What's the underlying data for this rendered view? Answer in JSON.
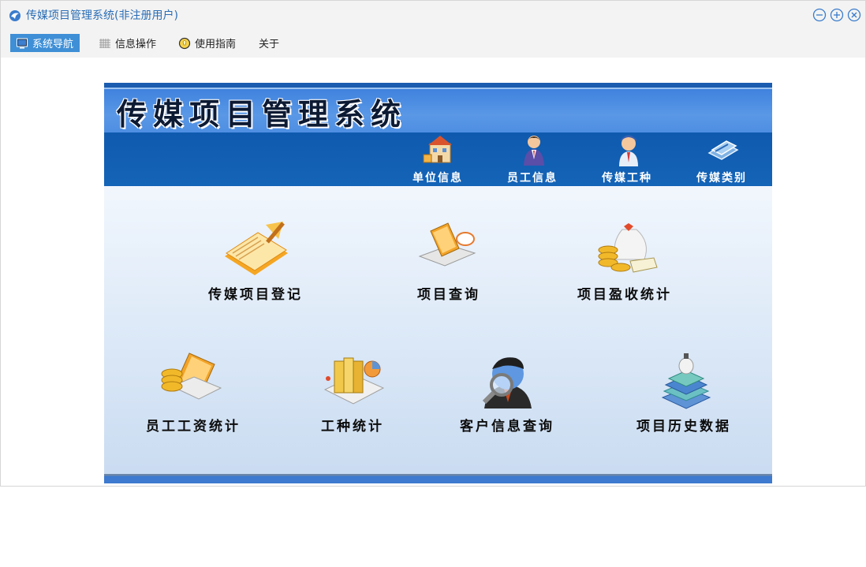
{
  "window": {
    "title": "传媒项目管理系统(非注册用户)"
  },
  "menu": [
    {
      "label": "系统导航",
      "icon": "monitor-icon",
      "active": true
    },
    {
      "label": "信息操作",
      "icon": "grid-icon",
      "active": false
    },
    {
      "label": "使用指南",
      "icon": "lightbulb-icon",
      "active": false
    },
    {
      "label": "关于",
      "icon": "",
      "active": false
    }
  ],
  "banner": {
    "title": "传媒项目管理系统"
  },
  "top_nav": [
    {
      "label": "单位信息",
      "icon": "building-icon"
    },
    {
      "label": "员工信息",
      "icon": "employee-icon"
    },
    {
      "label": "传媒工种",
      "icon": "worker-icon"
    },
    {
      "label": "传媒类别",
      "icon": "category-icon"
    }
  ],
  "features": [
    {
      "label": "传媒项目登记",
      "icon": "register-notebook-icon"
    },
    {
      "label": "项目查询",
      "icon": "laptop-search-icon"
    },
    {
      "label": "项目盈收统计",
      "icon": "money-bag-icon"
    },
    {
      "label": "员工工资统计",
      "icon": "salary-coins-icon"
    },
    {
      "label": "工种统计",
      "icon": "folders-chart-icon"
    },
    {
      "label": "客户信息查询",
      "icon": "customer-magnifier-icon"
    },
    {
      "label": "项目历史数据",
      "icon": "books-stack-icon"
    }
  ],
  "colors": {
    "accent": "#3f8fd6",
    "title_blue": "#2a6db5",
    "banner_blue": "#4e8ee2",
    "nav_blue": "#1464b8"
  }
}
